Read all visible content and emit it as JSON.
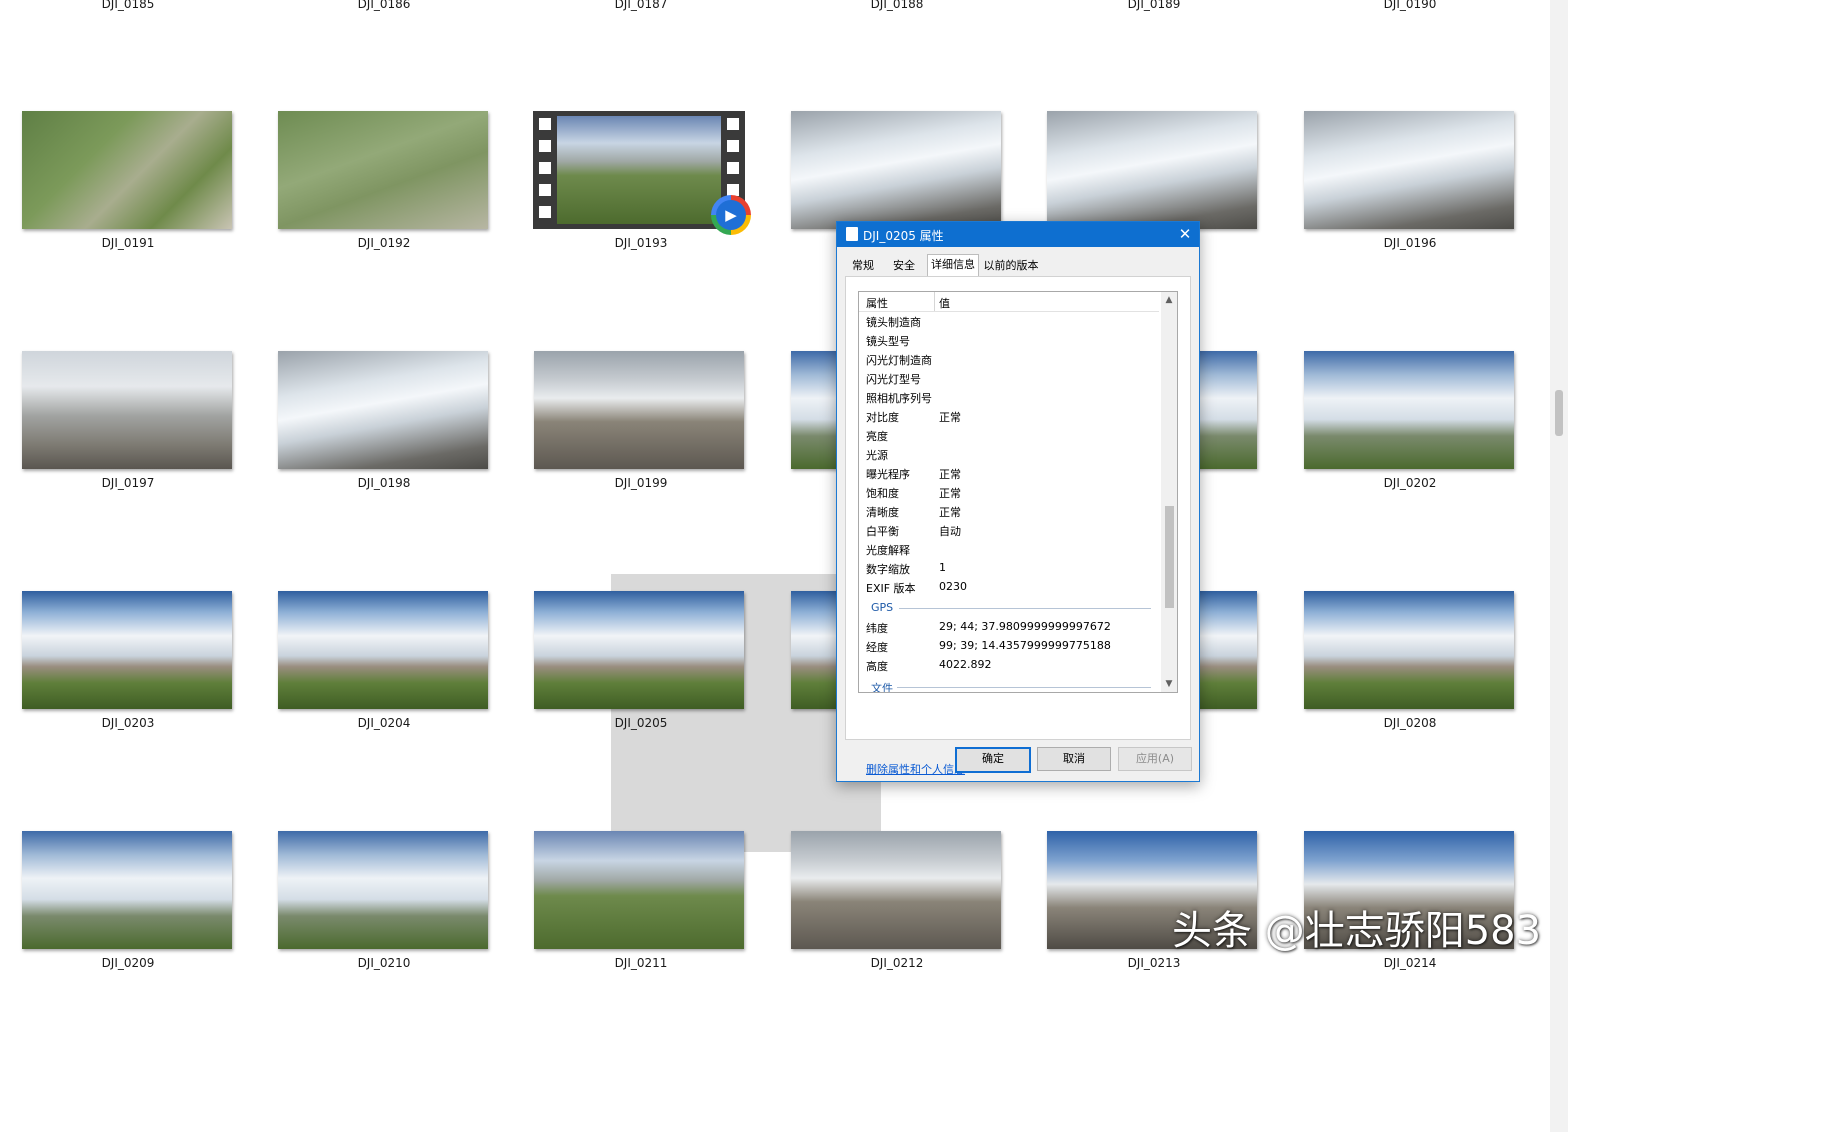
{
  "top_row_labels": [
    "DJI_0185",
    "DJI_0186",
    "DJI_0187",
    "DJI_0188",
    "DJI_0189",
    "DJI_0190"
  ],
  "row1": [
    "DJI_0191",
    "DJI_0192",
    "DJI_0193",
    "",
    "",
    "DJI_0196"
  ],
  "row2": [
    "DJI_0197",
    "DJI_0198",
    "DJI_0199",
    "",
    "",
    "DJI_0202"
  ],
  "row3": [
    "DJI_0203",
    "DJI_0204",
    "DJI_0205",
    "",
    "",
    "DJI_0208"
  ],
  "row4": [
    "DJI_0209",
    "DJI_0210",
    "DJI_0211",
    "DJI_0212",
    "DJI_0213",
    "DJI_0214"
  ],
  "dialog": {
    "title": "DJI_0205 属性",
    "tabs": [
      "常规",
      "安全",
      "详细信息",
      "以前的版本"
    ],
    "active_tab": "详细信息",
    "columns": {
      "name": "属性",
      "value": "值"
    },
    "rows": [
      {
        "k": "镜头制造商",
        "v": ""
      },
      {
        "k": "镜头型号",
        "v": ""
      },
      {
        "k": "闪光灯制造商",
        "v": ""
      },
      {
        "k": "闪光灯型号",
        "v": ""
      },
      {
        "k": "照相机序列号",
        "v": ""
      },
      {
        "k": "对比度",
        "v": "正常"
      },
      {
        "k": "亮度",
        "v": ""
      },
      {
        "k": "光源",
        "v": ""
      },
      {
        "k": "曝光程序",
        "v": "正常"
      },
      {
        "k": "饱和度",
        "v": "正常"
      },
      {
        "k": "清晰度",
        "v": "正常"
      },
      {
        "k": "白平衡",
        "v": "自动"
      },
      {
        "k": "光度解释",
        "v": ""
      },
      {
        "k": "数字缩放",
        "v": "1"
      },
      {
        "k": "EXIF 版本",
        "v": "0230"
      }
    ],
    "gps_group": "GPS",
    "gps_rows": [
      {
        "k": "纬度",
        "v": "29; 44; 37.9809999999997672"
      },
      {
        "k": "经度",
        "v": "99; 39; 14.4357999999775188"
      },
      {
        "k": "高度",
        "v": "4022.892"
      }
    ],
    "file_group": "文件",
    "remove_link": "删除属性和个人信息",
    "ok": "确定",
    "cancel": "取消",
    "apply": "应用(A)"
  },
  "watermark": "头条 @壮志骄阳583"
}
